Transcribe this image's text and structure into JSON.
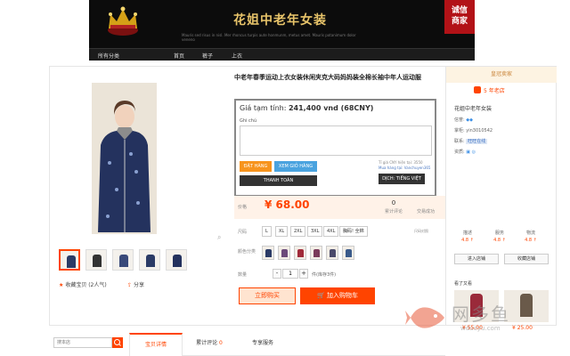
{
  "banner": {
    "store_name": "花姐中老年女装",
    "tagline": "Mauris sed risus in nisl. Mer rhoncus turpis aute honmunm, metus amet. Mauris potanimum dolor veneno",
    "badge_top": "诚信",
    "badge_bottom": "商家",
    "nav": [
      "所有分类",
      "首页",
      "裤子",
      "上衣"
    ]
  },
  "product": {
    "title": "中老年春季运动上衣女装休闲夹克大码妈妈装全棉长袖中年人运动服",
    "thumbnails": [
      "thumb1",
      "thumb2",
      "thumb3",
      "thumb4",
      "thumb5"
    ],
    "favorite_label": "收藏宝贝 (2人气)",
    "share_label": "分享"
  },
  "plugin": {
    "price_label": "Giá tạm tính:",
    "price_value": "241,400 vnd (68CNY)",
    "note_label": "Ghi chú",
    "order_button": "ĐẶT HÀNG",
    "cart_button": "XEM GIỎ HÀNG",
    "pay_button": "THANH TOÁN",
    "rate_text": "Tỉ giá CNY hiện tại: 3550",
    "buyer_text": "Mua hàng tại: Vanchuyen365",
    "lang_button": "DỊCH: TIẾNG VIỆT"
  },
  "pricing": {
    "label": "价格",
    "amount": "¥ 68.00",
    "reviews_count": "0",
    "reviews_label": "累计评论",
    "sales_count": "",
    "sales_label": "交易成功"
  },
  "options": {
    "size_label": "尺码",
    "sizes": [
      "L",
      "XL",
      "2XL",
      "3XL",
      "4XL",
      "胸码! 全棉"
    ],
    "size_note": "尺码对照",
    "color_label": "颜色分类",
    "colors": [
      "#2b3b66",
      "#6b4a7a",
      "#a02a3a",
      "#7a3a5a",
      "#4a4a6a",
      "#3a5a8a"
    ],
    "qty_label": "数量",
    "qty_minus": "-",
    "qty_value": "1",
    "qty_plus": "+",
    "stock": "件(库存3件)"
  },
  "actions": {
    "buy_now": "立即购买",
    "add_to_cart": "加入购物车"
  },
  "seller": {
    "header": "皇冠卖家",
    "years": "5 年老店",
    "shop_name": "花姐中老年女装",
    "fields": [
      {
        "label": "信誉:",
        "value": ""
      },
      {
        "label": "掌柜:",
        "value": "yin3010542"
      },
      {
        "label": "联系:",
        "value": "旺旺在线"
      },
      {
        "label": "资质:",
        "value": ""
      }
    ],
    "scores": [
      {
        "label": "描述",
        "value": "4.8 ↑"
      },
      {
        "label": "服务",
        "value": "4.8 ↑"
      },
      {
        "label": "物流",
        "value": "4.8 ↑"
      }
    ],
    "enter_shop": "进入店铺",
    "save_shop": "收藏店铺",
    "seen_label": "看了又看",
    "recs": [
      {
        "price": "¥ 55.00",
        "color": "#9a2a3a"
      },
      {
        "price": "¥ 25.00",
        "color": "#6a5a4a"
      }
    ]
  },
  "bottom": {
    "search_placeholder": "搜本店",
    "tabs": [
      {
        "label": "宝贝详情",
        "count": ""
      },
      {
        "label": "累计评论",
        "count": "0"
      },
      {
        "label": "专享服务",
        "count": ""
      }
    ]
  },
  "watermark": {
    "name": "网多鱼",
    "url": "wduoyu.com"
  }
}
